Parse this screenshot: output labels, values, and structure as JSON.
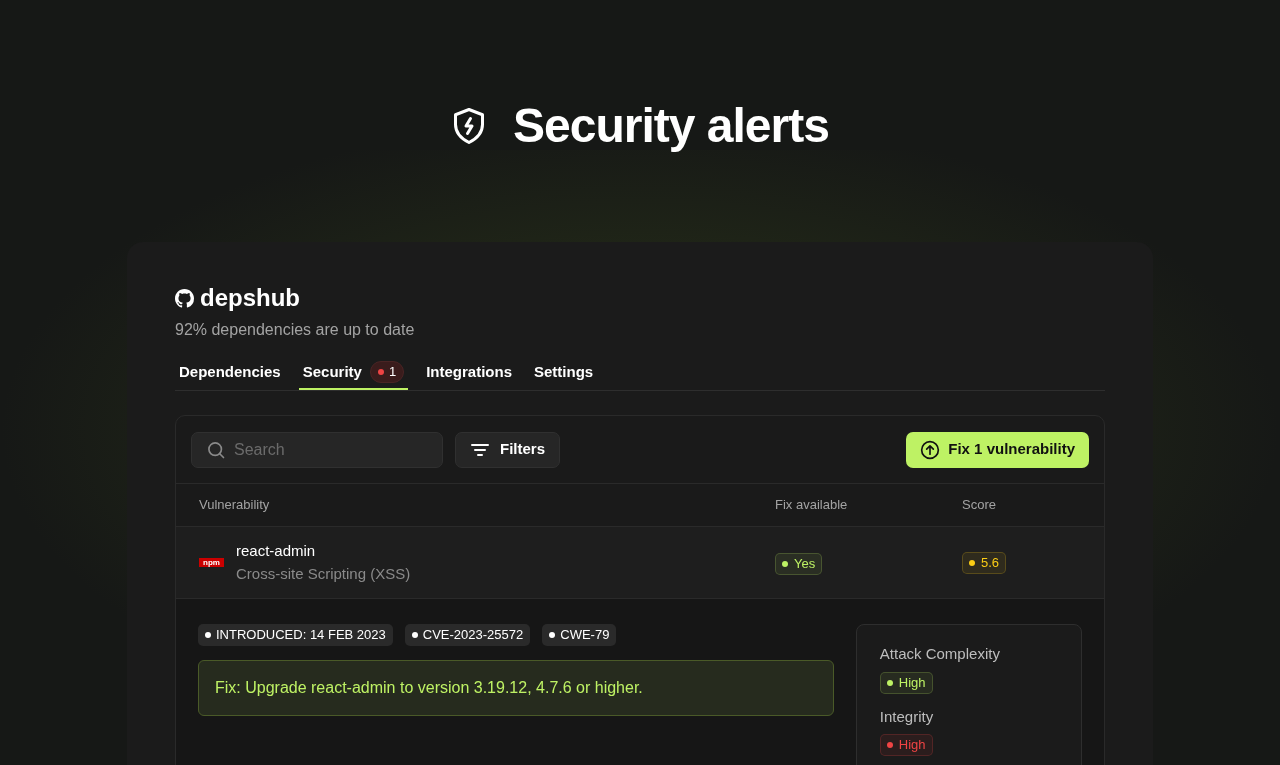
{
  "header": {
    "title": "Security alerts"
  },
  "project": {
    "name": "depshub",
    "subtitle": "92% dependencies are up to date"
  },
  "tabs": [
    {
      "label": "Dependencies",
      "selected": false
    },
    {
      "label": "Security",
      "selected": true,
      "badge": "1"
    },
    {
      "label": "Integrations",
      "selected": false
    },
    {
      "label": "Settings",
      "selected": false
    }
  ],
  "toolbar": {
    "search": {
      "placeholder": "Search"
    },
    "filters": "Filters",
    "fix_button": "Fix 1 vulnerability"
  },
  "table": {
    "columns": [
      "Vulnerability",
      "Fix available",
      "Score"
    ],
    "rows": [
      {
        "registry": "npm",
        "package": "react-admin",
        "issue": "Cross-site Scripting (XSS)",
        "fix": {
          "text": "Yes",
          "color": "#bef264"
        },
        "score": {
          "text": "5.6",
          "color": "#facc15"
        },
        "expanded": true,
        "details": {
          "tags": [
            "INTRODUCED: 14 FEB 2023",
            "CVE-2023-25572",
            "CWE-79"
          ],
          "fix_note": "Fix: Upgrade react-admin to version 3.19.12, 4.7.6 or higher.",
          "metrics": [
            {
              "label": "Attack Complexity",
              "value": "High",
              "color": "#bef264"
            },
            {
              "label": "Integrity",
              "value": "High",
              "color": "#ef4444"
            }
          ]
        }
      }
    ]
  }
}
